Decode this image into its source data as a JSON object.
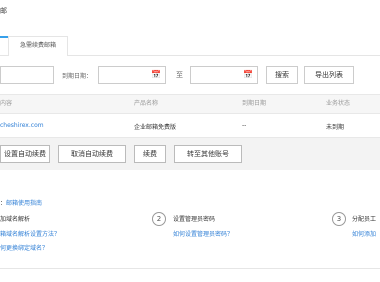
{
  "header": {
    "title": "邮"
  },
  "tabs": [
    {
      "label": ""
    },
    {
      "label": "急需续费邮箱"
    }
  ],
  "search": {
    "end_date_label": "到期日期：",
    "to_label": "至",
    "search_button": "搜索",
    "export_button": "导出列表"
  },
  "table": {
    "columns": [
      "内容",
      "产品名称",
      "到期日期",
      "业务状态"
    ],
    "rows": [
      {
        "domain": "cheshirex.com",
        "product": "企业邮箱免费版",
        "expiry": "--",
        "status": "未到期"
      }
    ]
  },
  "actions": {
    "set_auto_renew": "设置自动续费",
    "cancel_auto_renew": "取消自动续费",
    "renew": "续费",
    "transfer": "转至其他账号"
  },
  "guide": {
    "title_prefix": "：",
    "title_link": "邮箱使用指南",
    "steps": [
      {
        "num": "",
        "title": "加域名解析",
        "links": [
          "箱域名解析设置方法？",
          "何更换绑定域名？"
        ]
      },
      {
        "num": "2",
        "title": "设置管理员密码",
        "links": [
          "如何设置管理员密码？"
        ]
      },
      {
        "num": "3",
        "title": "分配员工",
        "links": [
          "如何添加"
        ]
      }
    ]
  },
  "icons": {
    "calendar": "calendar-icon"
  },
  "colors": {
    "accent": "#37a0ea",
    "link": "#2f7fd6"
  }
}
